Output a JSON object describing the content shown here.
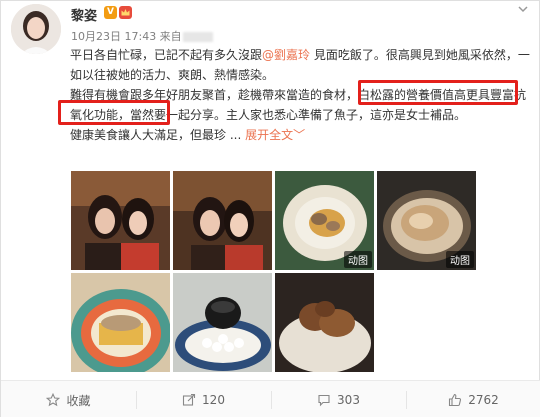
{
  "post": {
    "username": "黎姿",
    "vip_badge": "V",
    "meta_prefix": "10月23日 17:43 来自",
    "body": {
      "line1_a": "平日各自忙碌，已記不起有多久沒跟",
      "mention": "@劉嘉玲",
      "line1_b": " 見面吃飯了。很高興見到她風采依然，一如以往被她的活力、爽朗、熱情感染。",
      "para2": "難得有機會跟多年好朋友聚首，趁機帶來當造的食材，白松露的營養價值高更具豐富抗氧化功能，當然要一起分享。主人家也悉心準備了魚子，這亦是女士補品。",
      "para3": "健康美食讓人大滿足，但最珍",
      "ellipsis": " ...",
      "expand_label": "展开全文",
      "expand_chevron": "﹀"
    },
    "photos": [
      {
        "label": "",
        "icon": "photo-women-icon"
      },
      {
        "label": "",
        "icon": "photo-women-icon"
      },
      {
        "label": "",
        "icon": "photo-women-icon"
      },
      {
        "label": "动图",
        "icon": "photo-truffle-pasta-icon"
      },
      {
        "label": "动图",
        "icon": "photo-chicken-pot-icon"
      },
      {
        "label": "",
        "icon": "photo-truffle-toast-icon"
      },
      {
        "label": "",
        "icon": "photo-caviar-bowl-icon"
      },
      {
        "label": "",
        "icon": "photo-truffle-rice-icon"
      }
    ]
  },
  "actions": {
    "favorite": "收藏",
    "share": "120",
    "comment": "303",
    "like": "2762"
  },
  "colors": {
    "link": "#eb7350",
    "highlight_box": "#e3201b"
  }
}
